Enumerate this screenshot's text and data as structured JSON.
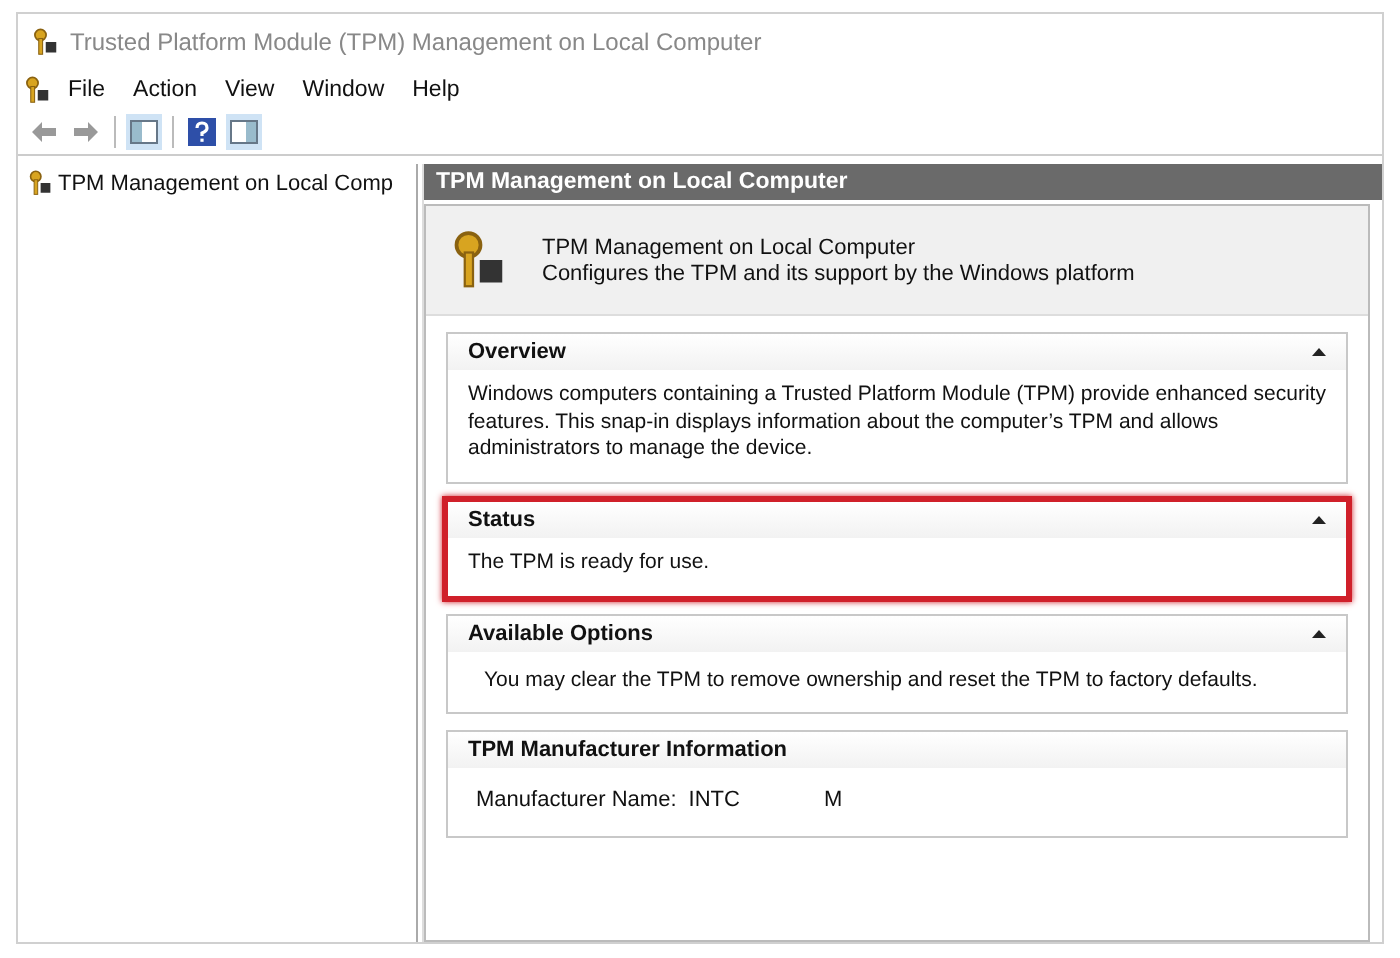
{
  "window": {
    "title": "Trusted Platform Module (TPM) Management on Local Computer"
  },
  "menu": [
    "File",
    "Action",
    "View",
    "Window",
    "Help"
  ],
  "tree": {
    "items": [
      {
        "label": "TPM Management on Local Comp",
        "selected": false
      }
    ]
  },
  "pane": {
    "header": "TPM Management on Local Computer",
    "info_title": "TPM Management on Local Computer",
    "info_subtitle": "Configures the TPM and its support by the Windows platform",
    "sections": [
      {
        "title": "Overview",
        "collapsible": true,
        "highlighted": false,
        "kind": "text",
        "text": "Windows computers containing a Trusted Platform Module (TPM) provide enhanced security features. This snap-in displays information about the computer’s TPM and allows administrators to manage the device."
      },
      {
        "title": "Status",
        "collapsible": true,
        "highlighted": true,
        "kind": "text",
        "text": "The TPM is ready for use."
      },
      {
        "title": "Available Options",
        "collapsible": true,
        "highlighted": false,
        "kind": "indented",
        "text": "You may clear the TPM to remove ownership and reset the TPM to factory defaults."
      },
      {
        "title": "TPM Manufacturer Information",
        "collapsible": false,
        "highlighted": false,
        "kind": "field",
        "label": "Manufacturer Name:",
        "values": [
          "INTC",
          "M"
        ]
      }
    ]
  }
}
